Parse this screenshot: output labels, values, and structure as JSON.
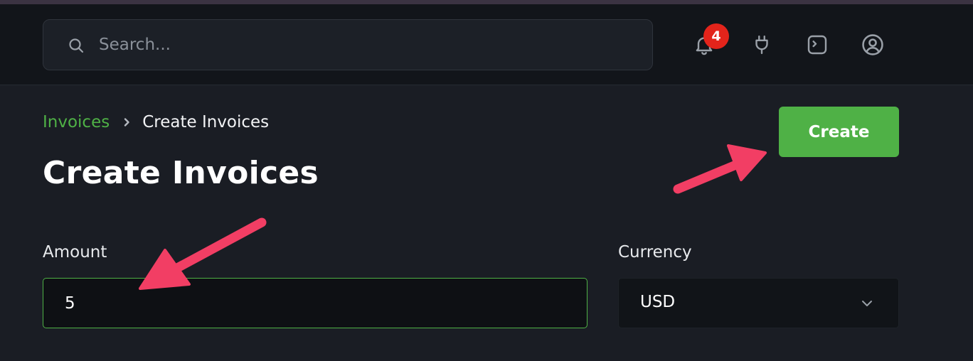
{
  "header": {
    "search": {
      "placeholder": "Search..."
    },
    "notifications": {
      "count": "4",
      "icon": "bell-icon"
    },
    "icons": [
      "bell-icon",
      "plug-icon",
      "terminal-icon",
      "user-circle-icon"
    ]
  },
  "breadcrumb": {
    "parent": "Invoices",
    "separator_icon": "chevron-right-icon",
    "current": "Create Invoices"
  },
  "page": {
    "title": "Create Invoices",
    "create_label": "Create"
  },
  "form": {
    "amount": {
      "label": "Amount",
      "value": "5"
    },
    "currency": {
      "label": "Currency",
      "value": "USD",
      "icon": "chevron-down-icon"
    }
  },
  "colors": {
    "accent": "#4fb146",
    "badge": "#e3241b",
    "annotation_arrow": "#f23e64",
    "background": "#1a1d24",
    "header_background": "#12151a"
  }
}
